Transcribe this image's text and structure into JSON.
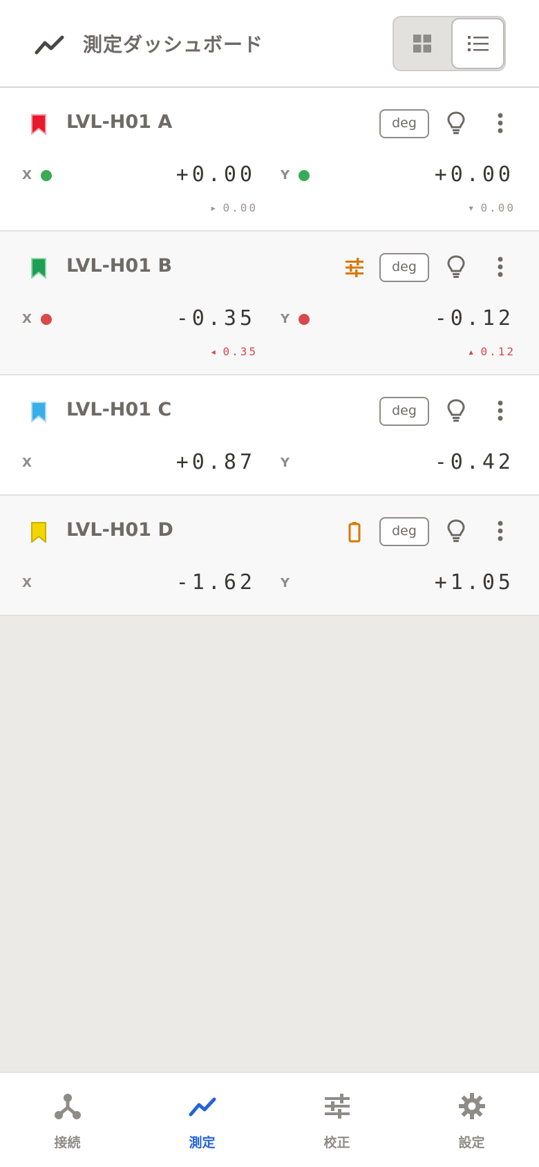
{
  "header": {
    "title": "測定ダッシュボード",
    "logo_icon": "trending-line-icon",
    "view_toggle": {
      "grid_icon": "grid-icon",
      "list_icon": "list-icon",
      "selected": "list"
    }
  },
  "colors": {
    "ok": "#3aaa55",
    "alert": "#d9494a",
    "warning": "#d97706",
    "accent": "#2563d9",
    "bookmarks": [
      "#e8192c",
      "#1f9e55",
      "#3aaee8",
      "#f2d600"
    ]
  },
  "cards": [
    {
      "name": "LVL-H01 A",
      "bookmark_icon": "bookmark-red-icon",
      "unit_button": "deg",
      "x": {
        "label": "X",
        "value": "+0.00",
        "delta": "0.00",
        "indicator": "green"
      },
      "y": {
        "label": "Y",
        "value": "+0.00",
        "delta": "0.00",
        "indicator": "green"
      }
    },
    {
      "name": "LVL-H01 B",
      "bookmark_icon": "bookmark-green-icon",
      "status_icon": "tune-icon",
      "unit_button": "deg",
      "x": {
        "label": "X",
        "value": "-0.35",
        "delta": "0.35",
        "indicator": "red"
      },
      "y": {
        "label": "Y",
        "value": "-0.12",
        "delta": "0.12",
        "indicator": "red"
      }
    },
    {
      "name": "LVL-H01 C",
      "bookmark_icon": "bookmark-blue-icon",
      "unit_button": "deg",
      "x": {
        "label": "X",
        "value": "+0.87"
      },
      "y": {
        "label": "Y",
        "value": "-0.42"
      }
    },
    {
      "name": "LVL-H01 D",
      "bookmark_icon": "bookmark-yellow-icon",
      "status_icon": "battery-icon",
      "unit_button": "deg",
      "x": {
        "label": "X",
        "value": "-1.62"
      },
      "y": {
        "label": "Y",
        "value": "+1.05"
      }
    }
  ],
  "bottom_nav": {
    "items": [
      {
        "label": "接続",
        "icon": "connection-icon"
      },
      {
        "label": "測定",
        "icon": "trending-line-icon",
        "active": true
      },
      {
        "label": "校正",
        "icon": "tune-icon"
      },
      {
        "label": "設定",
        "icon": "gear-icon"
      }
    ]
  }
}
